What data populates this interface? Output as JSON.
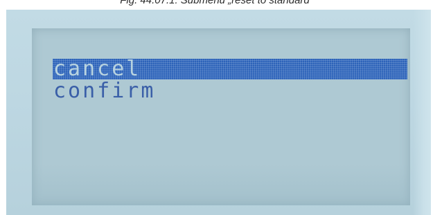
{
  "caption": "Fig. 44.07.1: Submenu „reset to standard“",
  "menu": {
    "items": [
      {
        "label": "cancel",
        "selected": true
      },
      {
        "label": "confirm",
        "selected": false
      }
    ]
  },
  "colors": {
    "lcd_background": "#aec9d3",
    "highlight": "#2d63b9",
    "text": "#3a5fa8"
  }
}
